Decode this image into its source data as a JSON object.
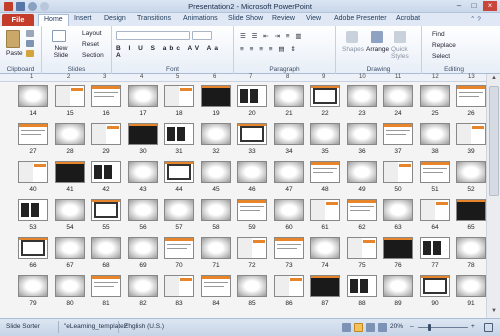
{
  "window": {
    "title": "Presentation2 - Microsoft PowerPoint"
  },
  "tabs": {
    "file": "File",
    "items": [
      "Home",
      "Insert",
      "Design",
      "Transitions",
      "Animations",
      "Slide Show",
      "Review",
      "View",
      "Adobe Presenter",
      "Acrobat"
    ]
  },
  "ribbon": {
    "clipboard": {
      "label": "Clipboard",
      "paste": "Paste"
    },
    "slides": {
      "label": "Slides",
      "new_slide": "New Slide",
      "layout": "Layout",
      "reset": "Reset",
      "section": "Section"
    },
    "font": {
      "label": "Font"
    },
    "paragraph": {
      "label": "Paragraph"
    },
    "drawing": {
      "label": "Drawing",
      "shapes": "Shapes",
      "arrange": "Arrange",
      "quick_styles": "Quick Styles"
    },
    "editing": {
      "label": "Editing",
      "find": "Find",
      "replace": "Replace",
      "select": "Select"
    }
  },
  "slides_top_numbers": [
    "1",
    "2",
    "3",
    "4",
    "5",
    "6",
    "7",
    "8",
    "9",
    "10",
    "11",
    "12",
    "13"
  ],
  "slide_numbers": [
    "14",
    "15",
    "16",
    "17",
    "18",
    "19",
    "20",
    "21",
    "22",
    "23",
    "24",
    "25",
    "26",
    "27",
    "28",
    "29",
    "30",
    "31",
    "32",
    "33",
    "34",
    "35",
    "36",
    "37",
    "38",
    "39",
    "40",
    "41",
    "42",
    "43",
    "44",
    "45",
    "46",
    "47",
    "48",
    "49",
    "50",
    "51",
    "52",
    "53",
    "54",
    "55",
    "56",
    "57",
    "58",
    "59",
    "60",
    "61",
    "62",
    "63",
    "64",
    "65",
    "66",
    "67",
    "68",
    "69",
    "70",
    "71",
    "72",
    "73",
    "74",
    "75",
    "76",
    "77",
    "78",
    "79",
    "80",
    "81",
    "82",
    "83",
    "84",
    "85",
    "86",
    "87",
    "88",
    "89",
    "90",
    "91"
  ],
  "status": {
    "view": "Slide Sorter",
    "theme": "\"eLearning_template2\"",
    "language": "English (U.S.)",
    "zoom": "20%"
  }
}
